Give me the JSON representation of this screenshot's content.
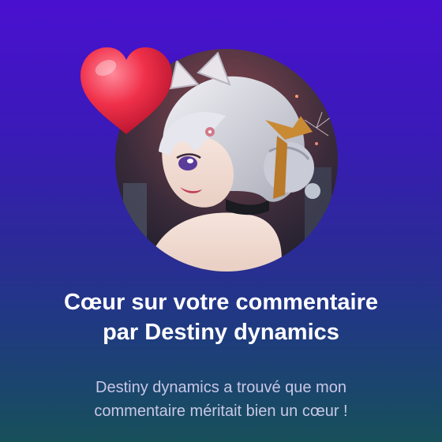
{
  "notification": {
    "title_line1": "Cœur sur votre commentaire",
    "title_line2": "par Destiny dynamics",
    "message_line1": "Destiny dynamics a trouvé que mon",
    "message_line2": "commentaire méritait bien un cœur !"
  },
  "icons": {
    "heart": "heart-icon",
    "avatar": "channel-avatar"
  },
  "colors": {
    "background_top": "#4a10d0",
    "background_bottom": "#17505a",
    "heart": "#f0304a",
    "title_text": "#ffffff",
    "message_text": "#c9c7e6"
  }
}
